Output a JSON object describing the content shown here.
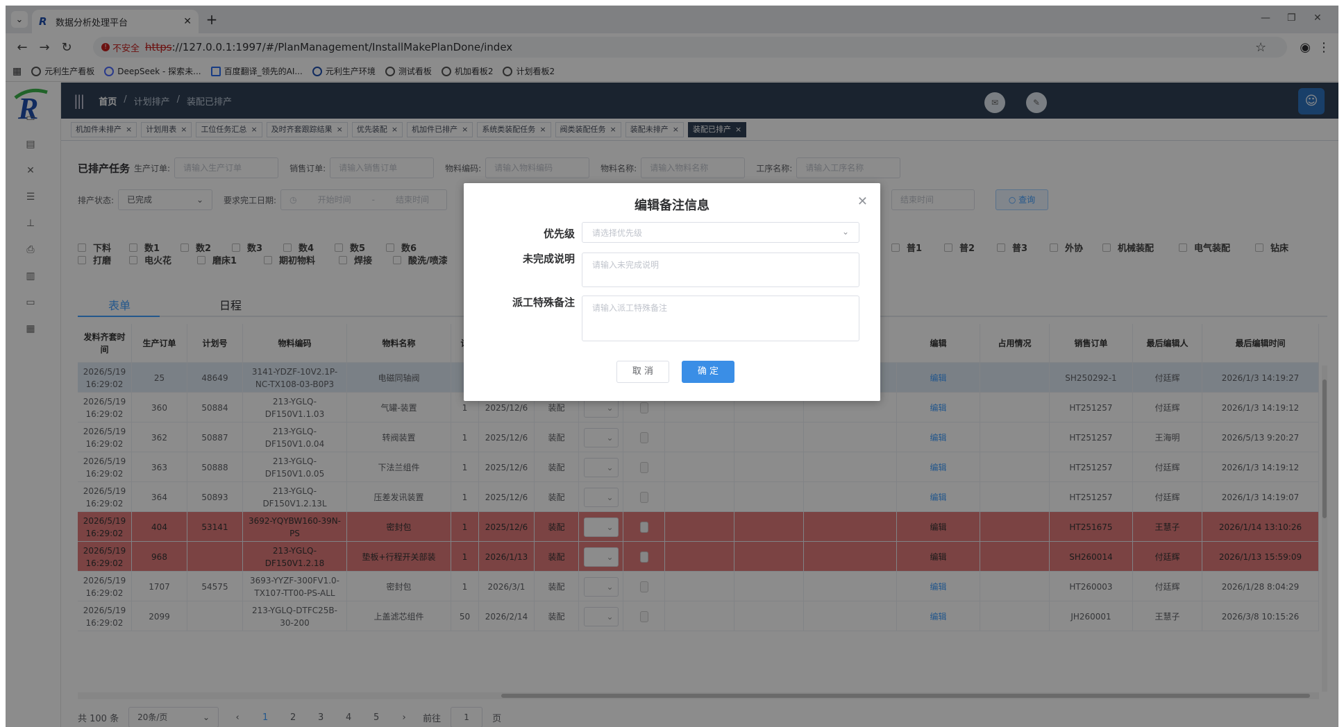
{
  "browser": {
    "tab_title": "数据分析处理平台",
    "insecure_label": "不安全",
    "url_scheme": "https",
    "url_rest": "://127.0.0.1:1997/#/PlanManagement/InstallMakePlanDone/index",
    "bookmarks": [
      "元利生产看板",
      "DeepSeek - 探索未...",
      "百度翻译_领先的AI...",
      "元利生产环境",
      "测试看板",
      "机加看板2",
      "计划看板2"
    ]
  },
  "header": {
    "breadcrumb": [
      "首页",
      "计划排产",
      "装配已排产"
    ]
  },
  "tags": [
    "机加件未排产",
    "计划用表",
    "工位任务汇总",
    "及时齐套跟踪结果",
    "优先装配",
    "机加件已排产",
    "系统类装配任务",
    "阀类装配任务",
    "装配未排产",
    "装配已排产"
  ],
  "filters": {
    "section_title": "已排产任务",
    "prod_order_label": "生产订单:",
    "prod_order_ph": "请输入生产订单",
    "sales_order_label": "销售订单:",
    "sales_order_ph": "请输入销售订单",
    "material_code_label": "物料编码:",
    "material_code_ph": "请输入物料编码",
    "material_name_label": "物料名称:",
    "material_name_ph": "请输入物料名称",
    "process_label": "工序名称:",
    "process_ph": "请输入工序名称",
    "status_label": "排产状态:",
    "status_value": "已完成",
    "due_label": "要求完工日期:",
    "start_ph": "开始时间",
    "range_sep": "-",
    "end_ph": "结束时间",
    "end_ph2": "结束时间",
    "query_label": "查询"
  },
  "checkboxes": {
    "row1": [
      "下料",
      "数1",
      "数2",
      "数3",
      "数4",
      "数5",
      "数6",
      "普1",
      "普2",
      "普3",
      "外协",
      "机械装配",
      "电气装配",
      "钻床"
    ],
    "row2": [
      "打磨",
      "电火花",
      "磨床1",
      "期初物料",
      "焊接",
      "酸洗/喷漆"
    ]
  },
  "view_tabs": [
    "表单",
    "日程"
  ],
  "table": {
    "headers": [
      "发料齐套时间",
      "生产订单",
      "计划号",
      "物料编码",
      "物料名称",
      "计",
      "编辑",
      "占用情况",
      "销售订单",
      "最后编辑人",
      "最后编辑时间"
    ],
    "rows": [
      {
        "time": "2026/5/19 16:29:02",
        "order": "25",
        "plan": "48649",
        "code": "3141-YDZF-10V2.1P-NC-TX108-03-B0P3",
        "name": "电磁同轴阀",
        "qty": "",
        "date": "",
        "type": "",
        "edit": "编辑",
        "sales": "SH250292-1",
        "editor": "付廷辉",
        "edit_time": "2026/1/3 14:19:27",
        "style": "hl"
      },
      {
        "time": "2026/5/19 16:29:02",
        "order": "360",
        "plan": "50884",
        "code": "213-YGLQ-DF150V1.1.03",
        "name": "气罐-装置",
        "qty": "1",
        "date": "2025/12/6",
        "type": "装配",
        "edit": "编辑",
        "sales": "HT251257",
        "editor": "付廷辉",
        "edit_time": "2026/1/3 14:19:12",
        "style": ""
      },
      {
        "time": "2026/5/19 16:29:02",
        "order": "362",
        "plan": "50887",
        "code": "213-YGLQ-DF150V1.0.04",
        "name": "转阀装置",
        "qty": "1",
        "date": "2025/12/6",
        "type": "装配",
        "edit": "编辑",
        "sales": "HT251257",
        "editor": "王海明",
        "edit_time": "2026/5/13 9:20:27",
        "style": ""
      },
      {
        "time": "2026/5/19 16:29:02",
        "order": "363",
        "plan": "50888",
        "code": "213-YGLQ-DF150V1.0.05",
        "name": "下法兰组件",
        "qty": "1",
        "date": "2025/12/6",
        "type": "装配",
        "edit": "编辑",
        "sales": "HT251257",
        "editor": "付廷辉",
        "edit_time": "2026/1/3 14:19:12",
        "style": ""
      },
      {
        "time": "2026/5/19 16:29:02",
        "order": "364",
        "plan": "50893",
        "code": "213-YGLQ-DF150V1.2.13L",
        "name": "压差发讯装置",
        "qty": "1",
        "date": "2025/12/6",
        "type": "装配",
        "edit": "编辑",
        "sales": "HT251257",
        "editor": "付廷辉",
        "edit_time": "2026/1/3 14:19:07",
        "style": ""
      },
      {
        "time": "2026/5/19 16:29:02",
        "order": "404",
        "plan": "53141",
        "code": "3692-YQYBW160-39N-PS",
        "name": "密封包",
        "qty": "1",
        "date": "2025/12/6",
        "type": "装配",
        "edit": "编辑",
        "sales": "HT251675",
        "editor": "王慧子",
        "edit_time": "2026/1/14 13:10:26",
        "style": "red"
      },
      {
        "time": "2026/5/19 16:29:02",
        "order": "968",
        "plan": "",
        "code": "213-YGLQ-DF150V1.2.18",
        "name": "垫板+行程开关部装",
        "qty": "1",
        "date": "2026/1/13",
        "type": "装配",
        "edit": "编辑",
        "sales": "SH260014",
        "editor": "付廷辉",
        "edit_time": "2026/1/13 15:59:09",
        "style": "red"
      },
      {
        "time": "2026/5/19 16:29:02",
        "order": "1707",
        "plan": "54575",
        "code": "3693-YYZF-300FV1.0-TX107-TT00-PS-ALL",
        "name": "密封包",
        "qty": "1",
        "date": "2026/3/1",
        "type": "装配",
        "edit": "编辑",
        "sales": "HT260003",
        "editor": "付廷辉",
        "edit_time": "2026/1/28 8:04:29",
        "style": ""
      },
      {
        "time": "2026/5/19 16:29:02",
        "order": "2099",
        "plan": "",
        "code": "213-YGLQ-DTFC25B-30-200",
        "name": "上盖滤芯组件",
        "qty": "50",
        "date": "2026/2/14",
        "type": "装配",
        "edit": "编辑",
        "sales": "JH260001",
        "editor": "王慧子",
        "edit_time": "2026/3/8 10:15:26",
        "style": ""
      }
    ]
  },
  "pager": {
    "total": "共 100 条",
    "page_size": "20条/页",
    "pages": [
      "1",
      "2",
      "3",
      "4",
      "5"
    ],
    "goto_label": "前往",
    "goto_value": "1",
    "page_suffix": "页"
  },
  "dialog": {
    "title": "编辑备注信息",
    "priority_label": "优先级",
    "priority_ph": "请选择优先级",
    "unfinished_label": "未完成说明",
    "unfinished_ph": "请输入未完成说明",
    "dispatch_label": "派工特殊备注",
    "dispatch_ph": "请输入派工特殊备注",
    "cancel": "取 消",
    "confirm": "确 定"
  },
  "colors": {
    "header": "#304156",
    "accent": "#409eff",
    "warning_row": "#e07a7a"
  }
}
